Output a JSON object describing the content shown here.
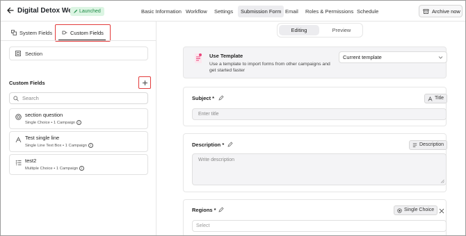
{
  "header": {
    "title": "Digital Detox Week",
    "status": "Launched",
    "tabs": [
      {
        "label": "Basic Information"
      },
      {
        "label": "Workflow"
      },
      {
        "label": "Settings"
      },
      {
        "label": "Submission Form"
      },
      {
        "label": "Email"
      },
      {
        "label": "Roles & Permissions"
      },
      {
        "label": "Schedule"
      }
    ],
    "active_tab": "Submission Form",
    "archive_label": "Archive now"
  },
  "left": {
    "tabs": {
      "system": "System Fields",
      "custom": "Custom Fields"
    },
    "section_label": "Section",
    "custom_fields_heading": "Custom Fields",
    "search_placeholder": "Search",
    "fields": [
      {
        "name": "section question",
        "meta": "Single Choice • 1 Campaign",
        "icon": "radio-icon"
      },
      {
        "name": "Test single line",
        "meta": "Single Line Text Box • 1 Campaign",
        "icon": "text-icon"
      },
      {
        "name": "test2",
        "meta": "Multiple Choice • 1 Campaign",
        "icon": "checklist-icon"
      }
    ]
  },
  "right": {
    "toggle": {
      "editing": "Editing",
      "preview": "Preview",
      "active": "Editing"
    },
    "template": {
      "title": "Use Template",
      "description": "Use a template to import forms from other campaigns and get started faster",
      "selected": "Current template"
    },
    "subject": {
      "label": "Subject *",
      "chip": "Title",
      "placeholder": "Enter title"
    },
    "description": {
      "label": "Description *",
      "chip": "Description",
      "placeholder": "Write description"
    },
    "regions": {
      "label": "Regions *",
      "chip": "Single Choice",
      "placeholder": "Select"
    }
  },
  "colors": {
    "accent_red": "#e23b3b",
    "launched_bg": "#dcf5e3",
    "launched_text": "#1d8a46"
  }
}
